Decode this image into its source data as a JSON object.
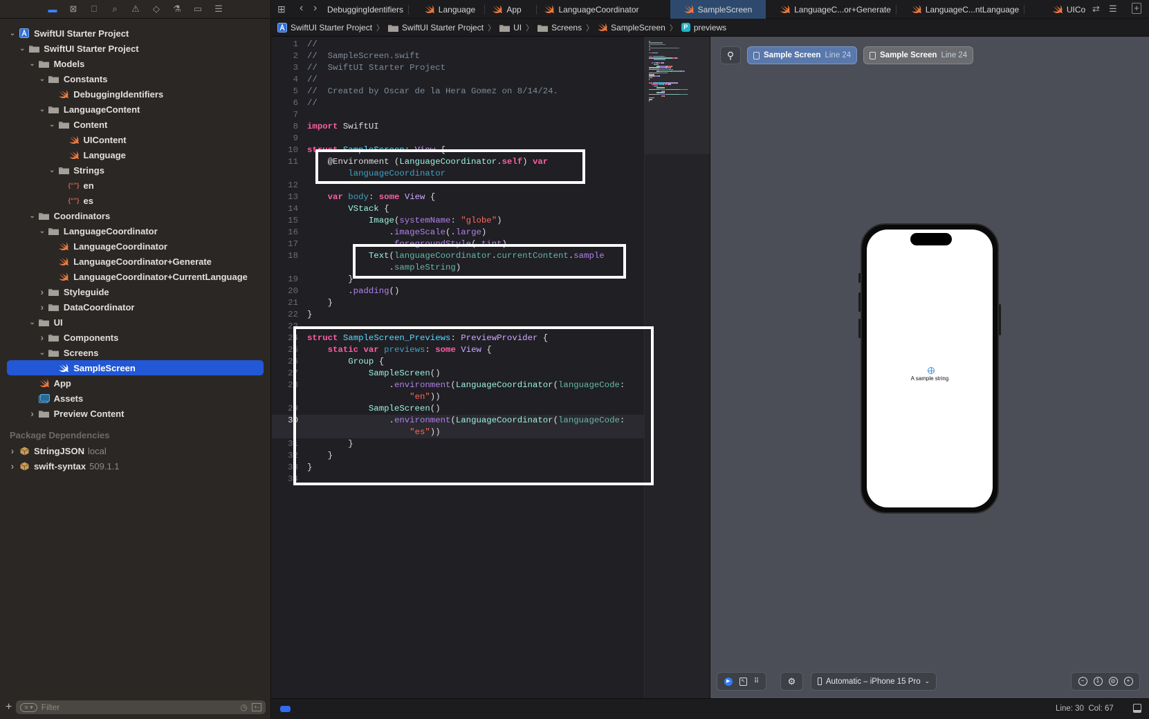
{
  "navigator_icons": [
    "folder-icon",
    "source-control-icon",
    "bookmark-icon",
    "search-icon",
    "warning-icon",
    "test-icon",
    "debug-icon",
    "breakpoint-icon",
    "report-icon"
  ],
  "sidebar": {
    "items": [
      {
        "label": "SwiftUI Starter Project",
        "level": 0,
        "kind": "project",
        "chevron": "open"
      },
      {
        "label": "SwiftUI Starter Project",
        "level": 1,
        "kind": "folder",
        "chevron": "open"
      },
      {
        "label": "Models",
        "level": 2,
        "kind": "folder",
        "chevron": "open"
      },
      {
        "label": "Constants",
        "level": 3,
        "kind": "folder",
        "chevron": "open"
      },
      {
        "label": "DebuggingIdentifiers",
        "level": 4,
        "kind": "swift",
        "chevron": "none"
      },
      {
        "label": "LanguageContent",
        "level": 3,
        "kind": "folder",
        "chevron": "open"
      },
      {
        "label": "Content",
        "level": 4,
        "kind": "folder",
        "chevron": "open"
      },
      {
        "label": "UIContent",
        "level": 5,
        "kind": "swift",
        "chevron": "none"
      },
      {
        "label": "Language",
        "level": 5,
        "kind": "swift",
        "chevron": "none"
      },
      {
        "label": "Strings",
        "level": 4,
        "kind": "folder",
        "chevron": "open"
      },
      {
        "label": "en",
        "level": 5,
        "kind": "strings",
        "chevron": "none"
      },
      {
        "label": "es",
        "level": 5,
        "kind": "strings",
        "chevron": "none"
      },
      {
        "label": "Coordinators",
        "level": 2,
        "kind": "folder",
        "chevron": "open"
      },
      {
        "label": "LanguageCoordinator",
        "level": 3,
        "kind": "folder",
        "chevron": "open"
      },
      {
        "label": "LanguageCoordinator",
        "level": 4,
        "kind": "swift",
        "chevron": "none"
      },
      {
        "label": "LanguageCoordinator+Generate",
        "level": 4,
        "kind": "swift",
        "chevron": "none"
      },
      {
        "label": "LanguageCoordinator+CurrentLanguage",
        "level": 4,
        "kind": "swift",
        "chevron": "none"
      },
      {
        "label": "Styleguide",
        "level": 3,
        "kind": "folder",
        "chevron": "closed"
      },
      {
        "label": "DataCoordinator",
        "level": 3,
        "kind": "folder",
        "chevron": "closed"
      },
      {
        "label": "UI",
        "level": 2,
        "kind": "folder",
        "chevron": "open"
      },
      {
        "label": "Components",
        "level": 3,
        "kind": "folder",
        "chevron": "closed"
      },
      {
        "label": "Screens",
        "level": 3,
        "kind": "folder",
        "chevron": "open"
      },
      {
        "label": "SampleScreen",
        "level": 4,
        "kind": "swift",
        "chevron": "none",
        "selected": true
      },
      {
        "label": "App",
        "level": 2,
        "kind": "swift",
        "chevron": "none"
      },
      {
        "label": "Assets",
        "level": 2,
        "kind": "assets",
        "chevron": "none"
      },
      {
        "label": "Preview Content",
        "level": 2,
        "kind": "folder",
        "chevron": "closed"
      }
    ],
    "package_header": "Package Dependencies",
    "packages": [
      {
        "label": "StringJSON",
        "extra": "local"
      },
      {
        "label": "swift-syntax",
        "extra": "509.1.1"
      }
    ],
    "filter_placeholder": "Filter"
  },
  "tabs": [
    {
      "label": "DebuggingIdentifiers",
      "swift": false
    },
    {
      "label": "Language",
      "swift": true
    },
    {
      "label": "App",
      "swift": true
    },
    {
      "label": "LanguageCoordinator",
      "swift": true
    },
    {
      "label": "SampleScreen",
      "swift": true,
      "active": true
    },
    {
      "label": "LanguageC...or+Generate",
      "swift": true
    },
    {
      "label": "LanguageC...ntLanguage",
      "swift": true
    },
    {
      "label": "UICo",
      "swift": true
    }
  ],
  "breadcrumb": [
    {
      "label": "SwiftUI Starter Project",
      "icon": "project-icon"
    },
    {
      "label": "SwiftUI Starter Project",
      "icon": "folder-icon"
    },
    {
      "label": "UI",
      "icon": "folder-icon"
    },
    {
      "label": "Screens",
      "icon": "folder-icon"
    },
    {
      "label": "SampleScreen",
      "icon": "swift-icon"
    },
    {
      "label": "previews",
      "icon": "property-icon"
    }
  ],
  "editor": {
    "current_line": "30",
    "rows": [
      {
        "n": "1",
        "t": [
          [
            "c",
            "//"
          ]
        ]
      },
      {
        "n": "2",
        "t": [
          [
            "c",
            "//  SampleScreen.swift"
          ]
        ]
      },
      {
        "n": "3",
        "t": [
          [
            "c",
            "//  SwiftUI Starter Project"
          ]
        ]
      },
      {
        "n": "4",
        "t": [
          [
            "c",
            "//"
          ]
        ]
      },
      {
        "n": "5",
        "t": [
          [
            "c",
            "//  Created by Oscar de la Hera Gomez on 8/14/24."
          ]
        ]
      },
      {
        "n": "6",
        "t": [
          [
            "c",
            "//"
          ]
        ]
      },
      {
        "n": "7",
        "t": []
      },
      {
        "n": "8",
        "t": [
          [
            "k",
            "import"
          ],
          [
            "p",
            " SwiftUI"
          ]
        ]
      },
      {
        "n": "9",
        "t": []
      },
      {
        "n": "10",
        "t": [
          [
            "k",
            "struct"
          ],
          [
            "p",
            " "
          ],
          [
            "td",
            "SampleScreen"
          ],
          [
            "p",
            ": "
          ],
          [
            "sys",
            "View"
          ],
          [
            "p",
            " {"
          ]
        ]
      },
      {
        "n": "11",
        "t": [
          [
            "p",
            "    @Environment ("
          ],
          [
            "ty",
            "LanguageCoordinator"
          ],
          [
            "p",
            "."
          ],
          [
            "k",
            "self"
          ],
          [
            "p",
            ") "
          ],
          [
            "k",
            "var"
          ]
        ]
      },
      {
        "n": "",
        "t": [
          [
            "p",
            "        "
          ],
          [
            "dv",
            "languageCoordinator"
          ]
        ]
      },
      {
        "n": "12",
        "t": []
      },
      {
        "n": "13",
        "t": [
          [
            "p",
            "    "
          ],
          [
            "k",
            "var"
          ],
          [
            "p",
            " "
          ],
          [
            "dv",
            "body"
          ],
          [
            "p",
            ": "
          ],
          [
            "k",
            "some"
          ],
          [
            "p",
            " "
          ],
          [
            "sys",
            "View"
          ],
          [
            "p",
            " {"
          ]
        ]
      },
      {
        "n": "14",
        "t": [
          [
            "p",
            "        "
          ],
          [
            "ty",
            "VStack"
          ],
          [
            "p",
            " {"
          ]
        ]
      },
      {
        "n": "15",
        "t": [
          [
            "p",
            "            "
          ],
          [
            "ty",
            "Image"
          ],
          [
            "p",
            "("
          ],
          [
            "m",
            "systemName"
          ],
          [
            "p",
            ": "
          ],
          [
            "s",
            "\"globe\""
          ],
          [
            "p",
            ")"
          ]
        ]
      },
      {
        "n": "16",
        "t": [
          [
            "p",
            "                ."
          ],
          [
            "m",
            "imageScale"
          ],
          [
            "p",
            "(."
          ],
          [
            "m",
            "large"
          ],
          [
            "p",
            ")"
          ]
        ]
      },
      {
        "n": "17",
        "t": [
          [
            "p",
            "                ."
          ],
          [
            "m",
            "foregroundStyle"
          ],
          [
            "p",
            "(."
          ],
          [
            "m",
            "tint"
          ],
          [
            "p",
            ")"
          ]
        ]
      },
      {
        "n": "18",
        "t": [
          [
            "p",
            "            "
          ],
          [
            "ty",
            "Text"
          ],
          [
            "p",
            "("
          ],
          [
            "pr",
            "languageCoordinator"
          ],
          [
            "p",
            "."
          ],
          [
            "pr",
            "currentContent"
          ],
          [
            "p",
            "."
          ],
          [
            "m",
            "sample"
          ]
        ]
      },
      {
        "n": "",
        "t": [
          [
            "p",
            "                ."
          ],
          [
            "pr",
            "sampleString"
          ],
          [
            "p",
            ")"
          ]
        ]
      },
      {
        "n": "19",
        "t": [
          [
            "p",
            "        }"
          ]
        ]
      },
      {
        "n": "20",
        "t": [
          [
            "p",
            "        ."
          ],
          [
            "m",
            "padding"
          ],
          [
            "p",
            "()"
          ]
        ]
      },
      {
        "n": "21",
        "t": [
          [
            "p",
            "    }"
          ]
        ]
      },
      {
        "n": "22",
        "t": [
          [
            "p",
            "}"
          ]
        ]
      },
      {
        "n": "23",
        "t": []
      },
      {
        "n": "24",
        "t": [
          [
            "k",
            "struct"
          ],
          [
            "p",
            " "
          ],
          [
            "td",
            "SampleScreen_Previews"
          ],
          [
            "p",
            ": "
          ],
          [
            "sys",
            "PreviewProvider"
          ],
          [
            "p",
            " {"
          ]
        ]
      },
      {
        "n": "25",
        "t": [
          [
            "p",
            "    "
          ],
          [
            "k",
            "static var"
          ],
          [
            "p",
            " "
          ],
          [
            "dv",
            "previews"
          ],
          [
            "p",
            ": "
          ],
          [
            "k",
            "some"
          ],
          [
            "p",
            " "
          ],
          [
            "sys",
            "View"
          ],
          [
            "p",
            " {"
          ]
        ]
      },
      {
        "n": "26",
        "t": [
          [
            "p",
            "        "
          ],
          [
            "ty",
            "Group"
          ],
          [
            "p",
            " {"
          ]
        ]
      },
      {
        "n": "27",
        "t": [
          [
            "p",
            "            "
          ],
          [
            "ty",
            "SampleScreen"
          ],
          [
            "p",
            "()"
          ]
        ]
      },
      {
        "n": "28",
        "t": [
          [
            "p",
            "                ."
          ],
          [
            "m",
            "environment"
          ],
          [
            "p",
            "("
          ],
          [
            "ty",
            "LanguageCoordinator"
          ],
          [
            "p",
            "("
          ],
          [
            "pr",
            "languageCode"
          ],
          [
            "p",
            ":"
          ]
        ]
      },
      {
        "n": "",
        "t": [
          [
            "p",
            "                    "
          ],
          [
            "s",
            "\"en\""
          ],
          [
            "p",
            "))"
          ]
        ]
      },
      {
        "n": "29",
        "t": [
          [
            "p",
            "            "
          ],
          [
            "ty",
            "SampleScreen"
          ],
          [
            "p",
            "()"
          ]
        ]
      },
      {
        "n": "30",
        "t": [
          [
            "p",
            "                ."
          ],
          [
            "m",
            "environment"
          ],
          [
            "p",
            "("
          ],
          [
            "ty",
            "LanguageCoordinator"
          ],
          [
            "p",
            "("
          ],
          [
            "pr",
            "languageCode"
          ],
          [
            "p",
            ":"
          ]
        ],
        "cur": true
      },
      {
        "n": "",
        "t": [
          [
            "p",
            "                    "
          ],
          [
            "s",
            "\"es\""
          ],
          [
            "p",
            "))"
          ]
        ],
        "cur": true
      },
      {
        "n": "31",
        "t": [
          [
            "p",
            "        }"
          ]
        ]
      },
      {
        "n": "32",
        "t": [
          [
            "p",
            "    }"
          ]
        ]
      },
      {
        "n": "33",
        "t": [
          [
            "p",
            "}"
          ]
        ]
      },
      {
        "n": "34",
        "t": []
      }
    ]
  },
  "preview": {
    "chips": [
      {
        "label": "Sample Screen",
        "line": "Line 24",
        "active": true
      },
      {
        "label": "Sample Screen",
        "line": "Line 24",
        "active": false
      }
    ],
    "device_text": "A sample string",
    "device_selector": "Automatic – iPhone 15 Pro",
    "zoom_icons": [
      "zoom-out-icon",
      "zoom-actual-icon",
      "zoom-fit-icon",
      "zoom-in-icon"
    ]
  },
  "status": {
    "position": "Line: 30  Col: 67"
  },
  "colors": {
    "accent": "#2257d6",
    "swift_orange": "#f0793b",
    "highlight_box": "#ffffff"
  }
}
